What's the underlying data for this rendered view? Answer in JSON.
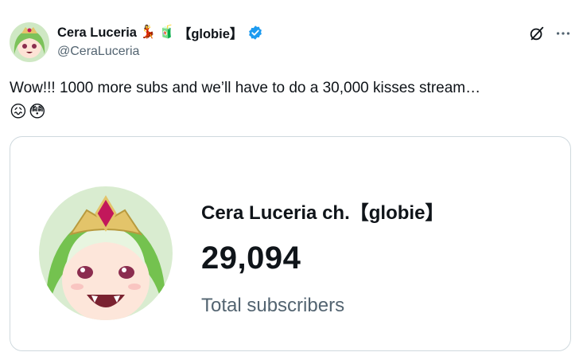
{
  "tweet": {
    "author": {
      "display_name": "Cera Luceria",
      "name_emojis": [
        "💃",
        "🧃"
      ],
      "name_suffix": "【globie】",
      "handle": "@CeraLuceria",
      "verified": true,
      "verified_color": "#1d9bf0"
    },
    "text": "Wow!!! 1000 more subs and we’ll have to do a 30,000 kisses stream…",
    "text_emojis": [
      "😖",
      "😳"
    ],
    "actions": {
      "grok_icon": "grok-icon",
      "more_icon": "more-icon"
    }
  },
  "card": {
    "channel_name": "Cera Luceria ch.【globie】",
    "subscriber_count": "29,094",
    "subscriber_label": "Total subscribers"
  }
}
